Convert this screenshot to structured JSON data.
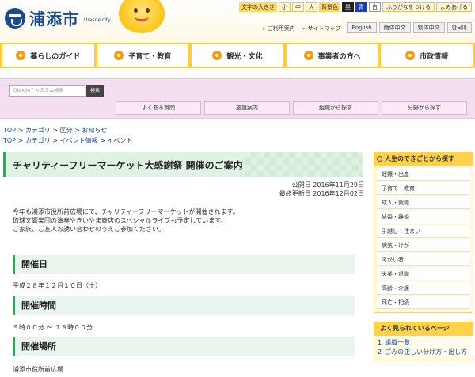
{
  "header": {
    "logo_text": "浦添市",
    "logo_sub": "Urasoe city",
    "font_size_label": "文字の大きさ",
    "font_sizes": [
      "小",
      "中",
      "大"
    ],
    "bg_color_label": "背景色",
    "bg_colors": [
      "黒",
      "青",
      "白"
    ],
    "furigana": "ふりがなをつける",
    "read_aloud": "よみあげる",
    "subnav": [
      "ご利用案内",
      "サイトマップ"
    ],
    "languages": [
      "English",
      "簡体中文",
      "繁体中文",
      "한국어"
    ]
  },
  "mainnav": [
    "暮らしのガイド",
    "子育て・教育",
    "観光・文化",
    "事業者の方へ",
    "市政情報"
  ],
  "search": {
    "placeholder": "Google™カスタム検索",
    "button": "検索"
  },
  "band_links": [
    "よくある質問",
    "施設案内",
    "組織から探す",
    "分野から探す"
  ],
  "breadcrumbs": {
    "row1": [
      "TOP",
      "カテゴリ",
      "区分",
      "お知らせ"
    ],
    "row2": [
      "TOP",
      "カテゴリ",
      "イベント情報",
      "イベント"
    ]
  },
  "article": {
    "title": "チャリティーフリーマーケット大感謝祭 開催のご案内",
    "published": "公開日 2016年11月29日",
    "updated": "最終更新日 2016年12月02日",
    "intro": [
      "今年も浦添市役所前広場にて、チャリティーフリーマーケットが開催されます。",
      "琉球文響楽団の演奏やきいやま商店のスペシャルライブも予定しています。",
      "ご家族、ご友人お誘い合わせのうえご参加ください。"
    ],
    "sections": [
      {
        "heading": "開催日",
        "value": "平成２８年１２月１０日（土）"
      },
      {
        "heading": "開催時間",
        "value": "９時００分 ～ １８時００分"
      },
      {
        "heading": "開催場所",
        "value": "浦添市役所前広場"
      }
    ]
  },
  "sidebar": {
    "heading": "人生のできごとから探す",
    "items": [
      "妊娠・出産",
      "子育て・教育",
      "成人・就職",
      "結婚・離婚",
      "引越し・住まい",
      "病気・けが",
      "障がい者",
      "失業・退職",
      "高齢・介護",
      "死亡・相続"
    ]
  },
  "popular": {
    "heading": "よく見られているページ",
    "items": [
      {
        "num": "1",
        "label": "組織一覧"
      },
      {
        "num": "2",
        "label": "ごみの正しい分け方・出し方"
      }
    ]
  }
}
